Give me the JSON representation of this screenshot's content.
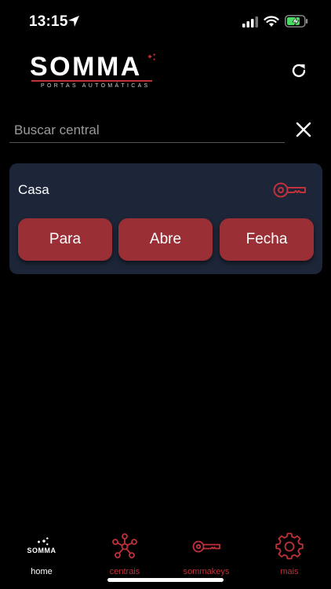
{
  "status_bar": {
    "time": "13:15",
    "icons": [
      "location-arrow-icon",
      "signal-icon",
      "wifi-icon",
      "battery-charging-icon"
    ]
  },
  "header": {
    "logo_text": "SOMMA",
    "logo_subtitle": "PORTAS AUTOMÁTICAS",
    "refresh_icon": "refresh-icon"
  },
  "search": {
    "value": "",
    "placeholder": "Buscar central",
    "clear_icon": "close-icon"
  },
  "centrais": [
    {
      "name": "Casa",
      "icon": "key-icon",
      "actions": [
        "Para",
        "Abre",
        "Fecha"
      ]
    }
  ],
  "bottom_nav": {
    "items": [
      {
        "label": "home",
        "icon": "somma-logo-icon",
        "active": true
      },
      {
        "label": "centrais",
        "icon": "network-icon"
      },
      {
        "label": "sommakeys",
        "icon": "key-icon"
      },
      {
        "label": "mais",
        "icon": "gear-icon"
      }
    ]
  },
  "colors": {
    "background": "#000000",
    "card": "#1d2638",
    "accent": "#9b2f36",
    "accent_text": "#c0313a",
    "battery": "#4cd964"
  }
}
